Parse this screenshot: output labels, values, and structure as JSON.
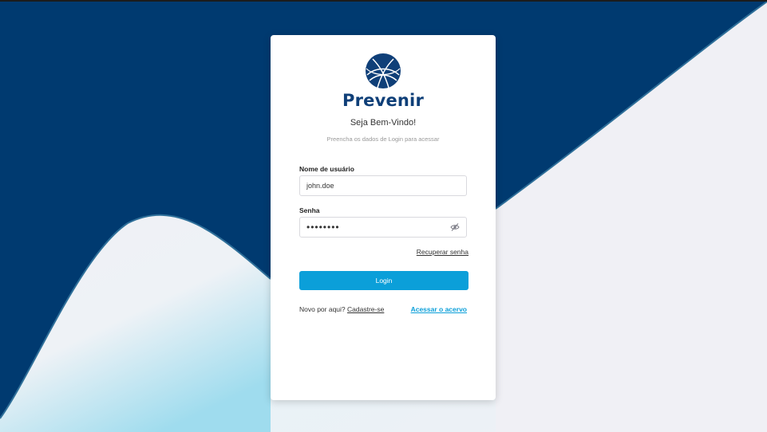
{
  "brand": {
    "name": "Prevenir",
    "colors": {
      "primary": "#0f3f78",
      "accent": "#0b9fd9",
      "background_dark": "#003a70"
    }
  },
  "login": {
    "welcome": "Seja Bem-Vindo!",
    "subtitle": "Preencha os dados de Login para acessar",
    "username_label": "Nome de usuário",
    "username_value": "john.doe",
    "password_label": "Senha",
    "password_value": "12345678",
    "password_toggle_icon": "eye-off-icon",
    "recover_link": "Recuperar senha",
    "submit_label": "Login",
    "signup_prompt": "Novo por aqui?",
    "signup_link": "Cadastre-se",
    "archive_link": "Acessar o acervo"
  }
}
